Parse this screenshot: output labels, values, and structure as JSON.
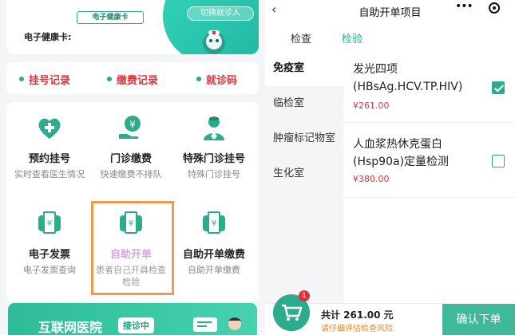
{
  "left": {
    "card": {
      "badge": "电子健康卡",
      "label": "电子健康卡:",
      "switch_label": "切换就诊人"
    },
    "quick_links": [
      "挂号记录",
      "缴费记录",
      "就诊码"
    ],
    "services": [
      {
        "title": "预约挂号",
        "subtitle": "实时查看医生情况",
        "icon": "heart-plus-icon"
      },
      {
        "title": "门诊缴费",
        "subtitle": "快速缴费不排队",
        "icon": "yen-hand-icon"
      },
      {
        "title": "特殊门诊挂号",
        "subtitle": "特殊门诊挂号",
        "icon": "doctor-icon"
      },
      {
        "title": "电子发票",
        "subtitle": "电子发票查询",
        "icon": "receipt-printer-icon"
      },
      {
        "title": "自助开单",
        "subtitle": "患者自己开具检查检验",
        "icon": "receipt-printer-icon",
        "highlighted": true
      },
      {
        "title": "自助开单缴费",
        "subtitle": "自助开单缴费",
        "icon": "receipt-printer-icon"
      }
    ],
    "internet_hospital": {
      "title": "互联网医院",
      "badge": "接诊中"
    }
  },
  "right": {
    "nav": {
      "back_icon": "chevron-left-icon",
      "title": "自助开单项目"
    },
    "tabs": [
      {
        "label": "检查",
        "active": false
      },
      {
        "label": "检验",
        "active": true
      }
    ],
    "categories": [
      {
        "label": "免疫室",
        "active": true
      },
      {
        "label": "临检室",
        "active": false
      },
      {
        "label": "肿瘤标记物室",
        "active": false
      },
      {
        "label": "生化室",
        "active": false
      }
    ],
    "items": [
      {
        "name": "发光四项(HBsAg.HCV.TP.HIV)",
        "price": "¥261.00",
        "checked": true
      },
      {
        "name": "人血浆热休克蛋白(Hsp90a)定量检测",
        "price": "¥380.00",
        "checked": false
      }
    ],
    "cart": {
      "count": "1",
      "total": "共计 261.00 元",
      "risk_note": "请仔细评估检查风险",
      "confirm_label": "确认下单"
    }
  },
  "colors": {
    "accent": "#2eaa8c",
    "price_red": "#e0313a",
    "highlight_frame": "#f29a4a"
  }
}
